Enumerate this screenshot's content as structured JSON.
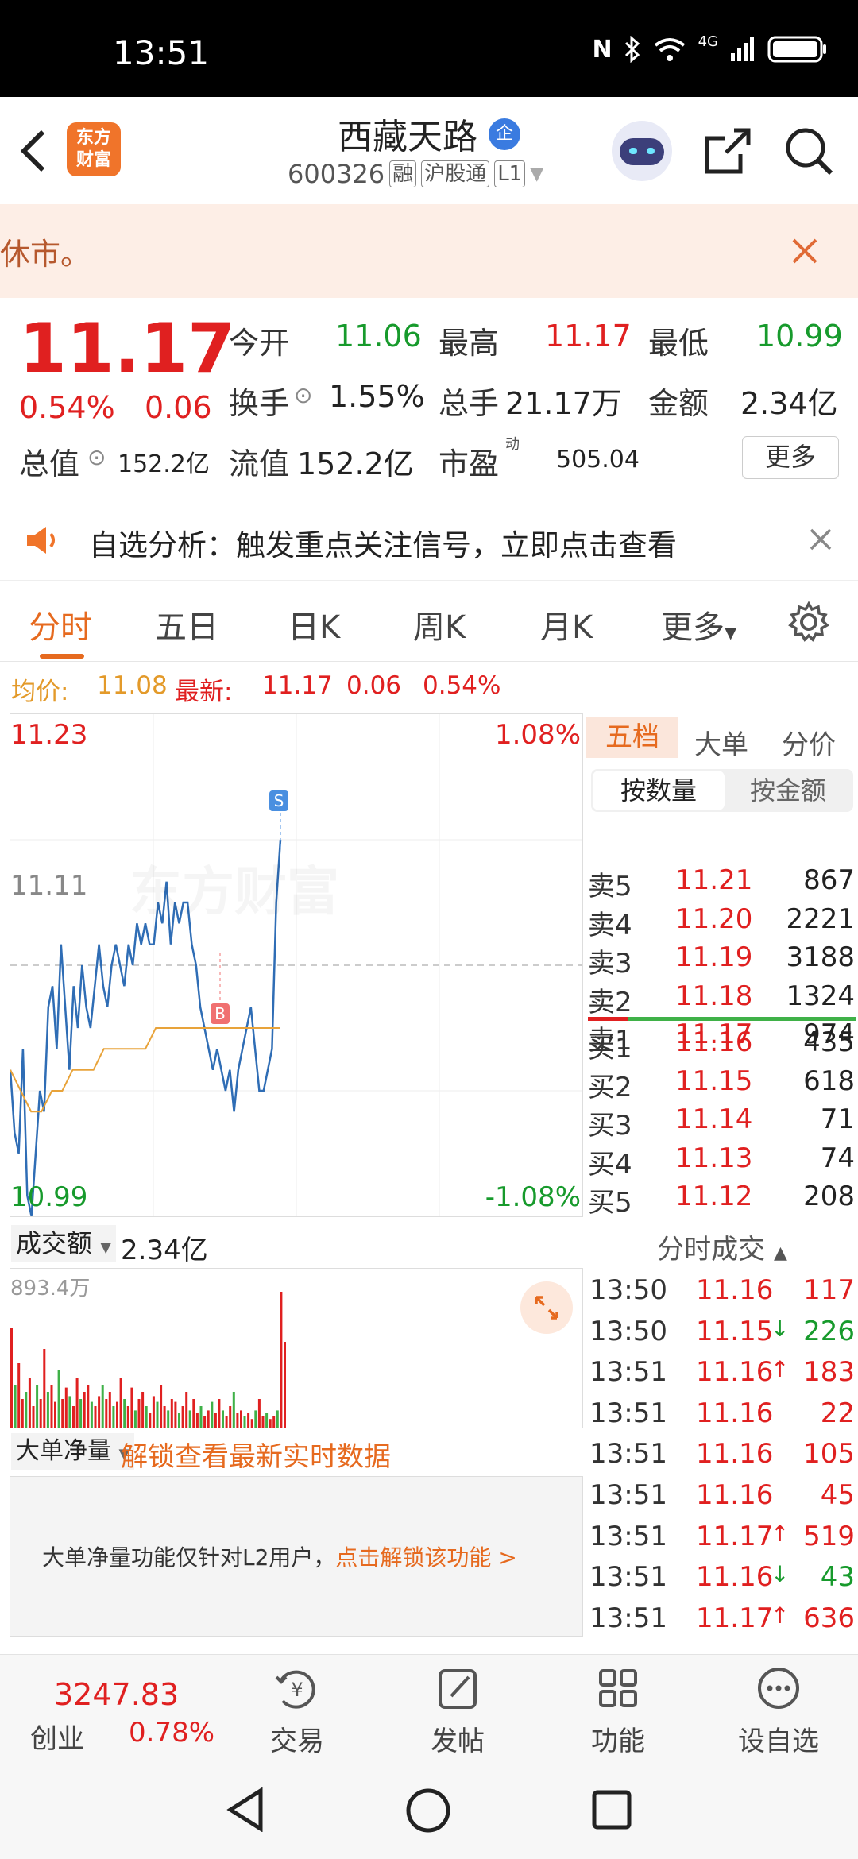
{
  "status_bar": {
    "time": "13:51",
    "network": "4G"
  },
  "header": {
    "logo_line1": "东方",
    "logo_line2": "财富",
    "title": "西藏天路",
    "title_badge": "企",
    "code": "600326",
    "tag_margin": "融",
    "tag_connect": "沪股通",
    "tag_level": "L1"
  },
  "notice": {
    "text": "休市。"
  },
  "quote": {
    "price": "11.17",
    "change_pct": "0.54%",
    "change": "0.06",
    "open_label": "今开",
    "open": "11.06",
    "high_label": "最高",
    "high": "11.17",
    "low_label": "最低",
    "low": "10.99",
    "turnover_label": "换手",
    "turnover": "1.55%",
    "volume_label": "总手",
    "volume": "21.17万",
    "amount_label": "金额",
    "amount": "2.34亿",
    "mktcap_label": "总值",
    "mktcap": "152.2亿",
    "float_label": "流值",
    "float": "152.2亿",
    "pe_label": "市盈",
    "pe_sup": "动",
    "pe": "505.04",
    "more_button": "更多"
  },
  "alert": {
    "text": "自选分析：触发重点关注信号，立即点击查看"
  },
  "tabs": [
    {
      "label": "分时",
      "active": true
    },
    {
      "label": "五日"
    },
    {
      "label": "日K"
    },
    {
      "label": "周K"
    },
    {
      "label": "月K"
    },
    {
      "label": "更多"
    }
  ],
  "avg_line": {
    "avg_label": "均价:",
    "avg": "11.08",
    "latest_label": "最新:",
    "latest": "11.17",
    "change": "0.06",
    "change_pct": "0.54%"
  },
  "chart_labels": {
    "top_left": "11.23",
    "top_right": "1.08%",
    "mid": "11.11",
    "bottom_left": "10.99",
    "bottom_right": "-1.08%",
    "marker_s": "S",
    "marker_b": "B",
    "watermark": "东方财富"
  },
  "chart_data": {
    "type": "line",
    "title": "",
    "ylim": [
      10.99,
      11.23
    ],
    "prev_close": 11.11,
    "series": [
      {
        "name": "",
        "color": "#2f6db5",
        "values": [
          11.06,
          11.03,
          11.02,
          11.07,
          11.0,
          10.99,
          11.02,
          11.05,
          11.04,
          11.09,
          11.1,
          11.07,
          11.12,
          11.09,
          11.06,
          11.1,
          11.08,
          11.11,
          11.09,
          11.08,
          11.1,
          11.12,
          11.1,
          11.09,
          11.11,
          11.12,
          11.11,
          11.1,
          11.12,
          11.11,
          11.13,
          11.12,
          11.13,
          11.12,
          11.12,
          11.14,
          11.13,
          11.15,
          11.12,
          11.14,
          11.13,
          11.14,
          11.14,
          11.12,
          11.11,
          11.09,
          11.08,
          11.07,
          11.06,
          11.07,
          11.06,
          11.05,
          11.06,
          11.04,
          11.06,
          11.07,
          11.08,
          11.09,
          11.07,
          11.05,
          11.05,
          11.06,
          11.07,
          11.14,
          11.17
        ]
      },
      {
        "name": "",
        "color": "#e8a33a",
        "values": [
          11.06,
          11.05,
          11.04,
          11.04,
          11.05,
          11.05,
          11.06,
          11.06,
          11.06,
          11.07,
          11.07,
          11.07,
          11.07,
          11.07,
          11.08,
          11.08,
          11.08,
          11.08,
          11.08,
          11.08,
          11.08,
          11.08,
          11.08,
          11.08,
          11.08,
          11.08,
          11.08
        ]
      }
    ],
    "volume_max_label": "893.4万"
  },
  "order_book": {
    "tab_five": "五档",
    "tab_big": "大单",
    "tab_price": "分价",
    "toggle_qty": "按数量",
    "toggle_amt": "按金额",
    "asks": [
      {
        "label": "卖5",
        "price": "11.21",
        "vol": "867"
      },
      {
        "label": "卖4",
        "price": "11.20",
        "vol": "2221"
      },
      {
        "label": "卖3",
        "price": "11.19",
        "vol": "3188"
      },
      {
        "label": "卖2",
        "price": "11.18",
        "vol": "1324"
      },
      {
        "label": "卖1",
        "price": "11.17",
        "vol": "974"
      }
    ],
    "bids": [
      {
        "label": "买1",
        "price": "11.16",
        "vol": "435"
      },
      {
        "label": "买2",
        "price": "11.15",
        "vol": "618"
      },
      {
        "label": "买3",
        "price": "11.14",
        "vol": "71"
      },
      {
        "label": "买4",
        "price": "11.13",
        "vol": "74"
      },
      {
        "label": "买5",
        "price": "11.12",
        "vol": "208"
      }
    ]
  },
  "volume_section": {
    "selector": "成交额",
    "value": "2.34亿"
  },
  "big_order": {
    "selector": "大单净量",
    "unlock_link": "解锁查看最新实时数据",
    "msg": "大单净量功能仅针对L2用户，",
    "msg_link": "点击解锁该功能 >"
  },
  "trades": {
    "header": "分时成交",
    "rows": [
      {
        "time": "13:50",
        "price": "11.16",
        "arrow": "",
        "vol": "117",
        "color": "red"
      },
      {
        "time": "13:50",
        "price": "11.15",
        "arrow": "↓",
        "vol": "226",
        "color": "green"
      },
      {
        "time": "13:51",
        "price": "11.16",
        "arrow": "↑",
        "vol": "183",
        "color": "red"
      },
      {
        "time": "13:51",
        "price": "11.16",
        "arrow": "",
        "vol": "22",
        "color": "red"
      },
      {
        "time": "13:51",
        "price": "11.16",
        "arrow": "",
        "vol": "105",
        "color": "red"
      },
      {
        "time": "13:51",
        "price": "11.16",
        "arrow": "",
        "vol": "45",
        "color": "red"
      },
      {
        "time": "13:51",
        "price": "11.17",
        "arrow": "↑",
        "vol": "519",
        "color": "red"
      },
      {
        "time": "13:51",
        "price": "11.16",
        "arrow": "↓",
        "vol": "43",
        "color": "green"
      },
      {
        "time": "13:51",
        "price": "11.17",
        "arrow": "↑",
        "vol": "636",
        "color": "red"
      }
    ]
  },
  "bottom_nav": {
    "index_value": "3247.83",
    "index_name": "创业",
    "index_change": "0.78%",
    "trade": "交易",
    "post": "发帖",
    "func": "功能",
    "watch": "设自选"
  }
}
